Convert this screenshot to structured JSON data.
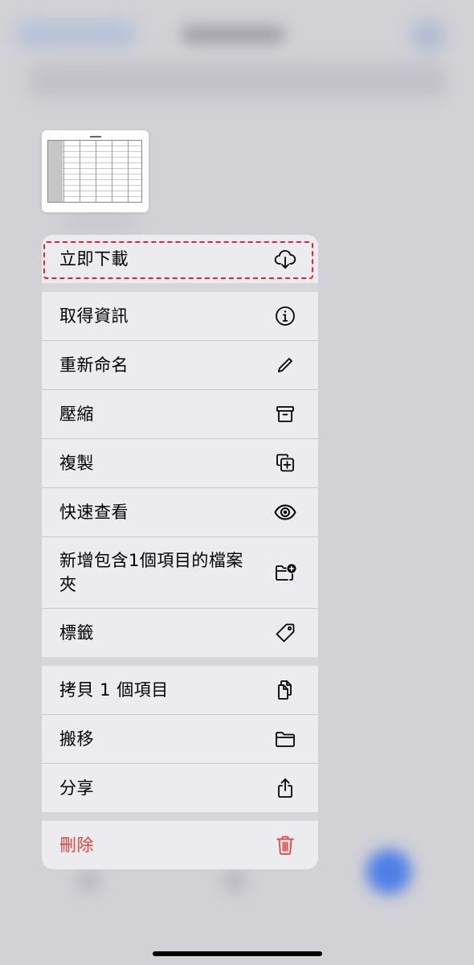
{
  "menu": {
    "download_now": "立即下載",
    "get_info": "取得資訊",
    "rename": "重新命名",
    "compress": "壓縮",
    "duplicate": "複製",
    "quick_look": "快速查看",
    "new_folder_line1": "新增包含1個項目的檔案",
    "new_folder_line2": "夾",
    "tags": "標籤",
    "copy_items": "拷貝 1 個項目",
    "move": "搬移",
    "share": "分享",
    "delete": "刪除"
  },
  "icons": {
    "download_now": "cloud-download-icon",
    "get_info": "info-icon",
    "rename": "pencil-icon",
    "compress": "archive-box-icon",
    "duplicate": "duplicate-icon",
    "quick_look": "eye-icon",
    "new_folder": "folder-plus-icon",
    "tags": "tag-icon",
    "copy_items": "documents-icon",
    "move": "folder-icon",
    "share": "share-icon",
    "delete": "trash-icon"
  },
  "colors": {
    "destructive": "#e5443a",
    "highlight": "#e5252a",
    "accent": "#4e7fe6"
  }
}
